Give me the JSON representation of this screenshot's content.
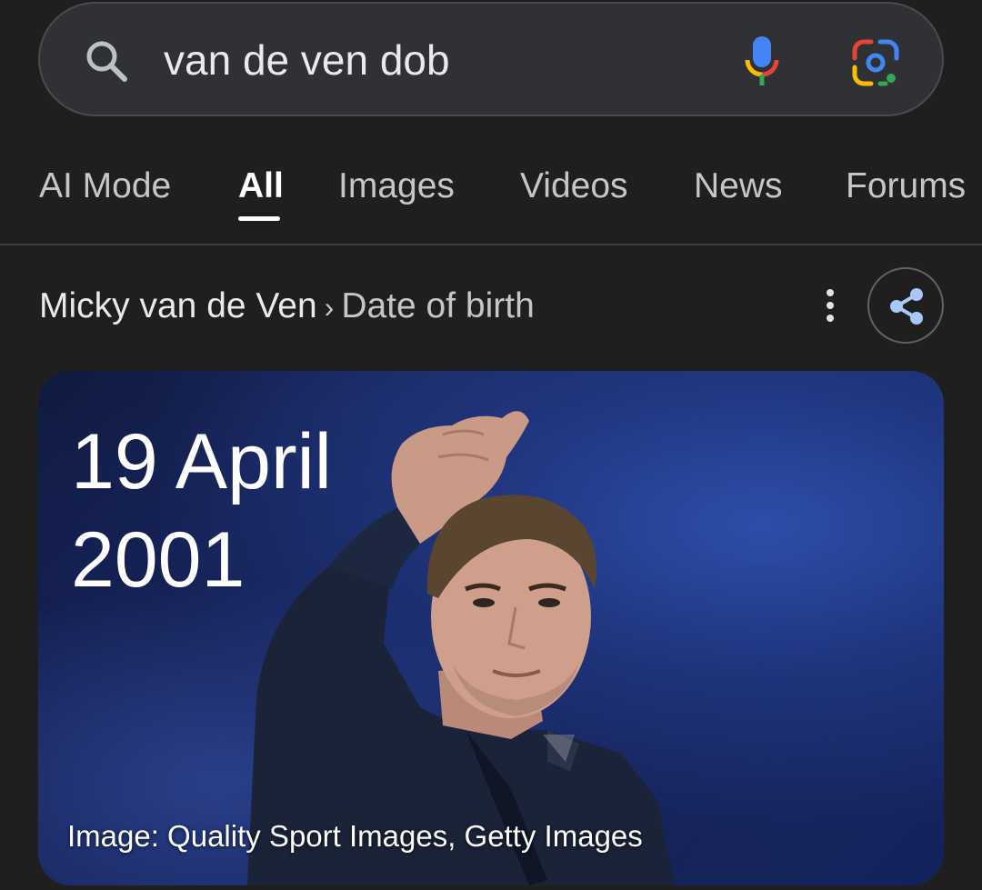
{
  "search": {
    "query": "van de ven dob",
    "icons": {
      "search": "search-icon",
      "voice": "mic-icon",
      "lens": "google-lens-icon"
    }
  },
  "tabs": [
    {
      "label": "AI Mode"
    },
    {
      "label": "All",
      "active": true
    },
    {
      "label": "Images"
    },
    {
      "label": "Videos"
    },
    {
      "label": "News"
    },
    {
      "label": "Forums"
    }
  ],
  "result": {
    "entity": "Micky van de Ven",
    "separator": "›",
    "attribute": "Date of birth",
    "answer_line1": "19 April",
    "answer_line2": "2001",
    "image_credit": "Image: Quality Sport Images, Getty Images",
    "icons": {
      "more": "more-vert-icon",
      "share": "share-icon"
    }
  },
  "colors": {
    "background": "#1f1f1f",
    "search_bar": "#303134",
    "mic_blue": "#4285f4",
    "mic_red": "#ea4335",
    "mic_yellow": "#fbbc04",
    "mic_green": "#34a853",
    "share_blue": "#a8c7fa"
  }
}
